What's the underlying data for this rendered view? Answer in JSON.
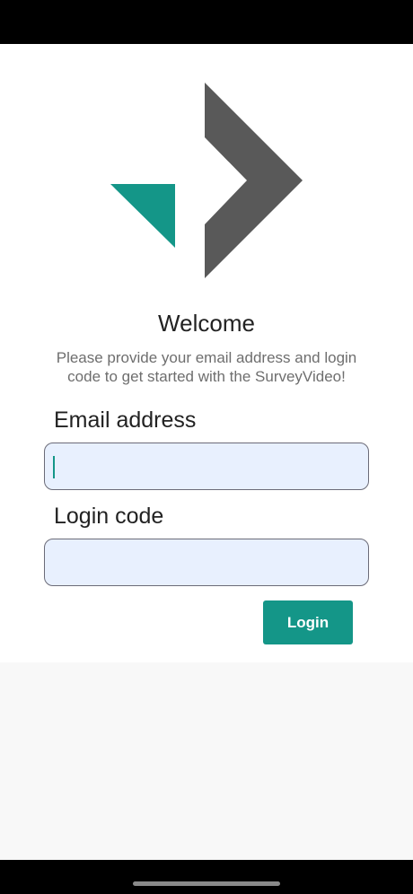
{
  "welcome": {
    "title": "Welcome",
    "subtitle": "Please provide your email address and login code to get started with the SurveyVideo!"
  },
  "form": {
    "email_label": "Email address",
    "email_value": "",
    "code_label": "Login code",
    "code_value": "",
    "login_label": "Login"
  },
  "colors": {
    "accent": "#149688",
    "logo_dark": "#595959",
    "field_background": "#e8f0fe"
  },
  "icons": {
    "logo": "surveyvideo-logo-icon"
  }
}
